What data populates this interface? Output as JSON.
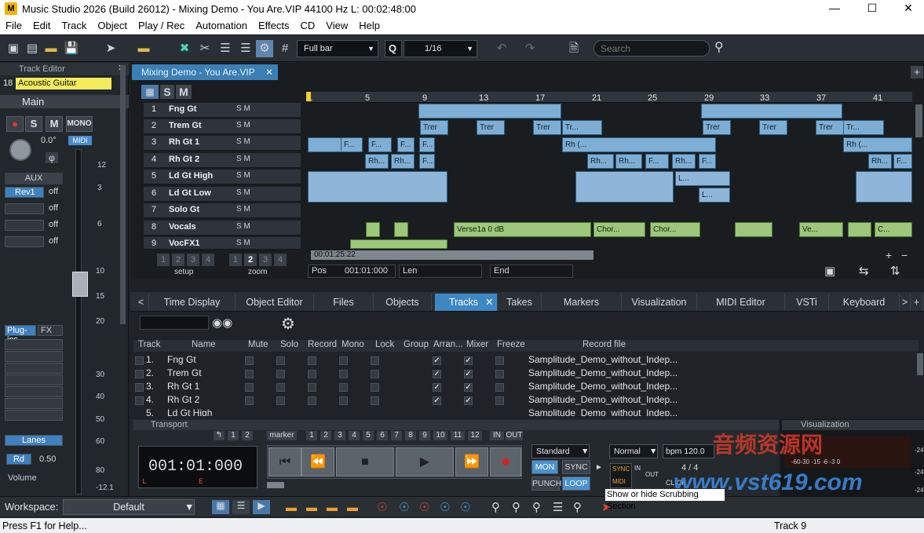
{
  "window": {
    "title": "Music Studio 2026 (Build 26012)  -  Mixing Demo - You Are.VIP    44100 Hz L: 00:02:48:00",
    "logo": "M"
  },
  "menu": [
    "File",
    "Edit",
    "Track",
    "Object",
    "Play / Rec",
    "Automation",
    "Effects",
    "CD",
    "View",
    "Help"
  ],
  "toolbar": {
    "snap_select": "Full bar",
    "quantize_label": "Q",
    "quantize_value": "1/16",
    "search_placeholder": "Search"
  },
  "track_editor": {
    "title": "Track Editor",
    "track_number": "18",
    "track_name": "Acoustic Guitar",
    "section": "Main",
    "buttons": [
      "S",
      "M",
      "MONO"
    ],
    "pan_value": "0.0°",
    "midi_label": "MIDI",
    "phase_symbol": "φ",
    "aux_label": "AUX",
    "sends": [
      {
        "name": "Rev1",
        "state": "off"
      },
      {
        "name": "",
        "state": "off"
      },
      {
        "name": "",
        "state": "off"
      },
      {
        "name": "",
        "state": "off"
      }
    ],
    "plugins_label": "Plug-ins",
    "fx_label": "FX",
    "lanes_label": "Lanes",
    "rd_label": "Rd",
    "rd_value": "0.50",
    "volume_label": "Volume",
    "scale": [
      "12",
      "3",
      "6",
      "10",
      "15",
      "20",
      "30",
      "40",
      "50",
      "60",
      "80",
      "-12.1"
    ]
  },
  "arranger": {
    "file_tab": "Mixing Demo - You Are.VIP",
    "s_label": "S",
    "m_label": "M",
    "ruler": [
      "1",
      "5",
      "9",
      "13",
      "17",
      "21",
      "25",
      "29",
      "33",
      "37",
      "41"
    ],
    "tracks": [
      {
        "num": "1",
        "name": "Fng Gt"
      },
      {
        "num": "2",
        "name": "Trem Gt"
      },
      {
        "num": "3",
        "name": "Rh Gt 1"
      },
      {
        "num": "4",
        "name": "Rh Gt 2"
      },
      {
        "num": "5",
        "name": "Ld Gt High"
      },
      {
        "num": "6",
        "name": "Ld Gt Low"
      },
      {
        "num": "7",
        "name": "Solo Gt"
      },
      {
        "num": "8",
        "name": "Vocals"
      },
      {
        "num": "9",
        "name": "VocFX1"
      }
    ],
    "sm_label": "S M",
    "clip_texts": {
      "trem": "Trer",
      "trem_fx": "Tr...",
      "rh1": "Rh (...",
      "rh2": "Rh...",
      "f": "F...",
      "l": "L...",
      "verse": "Verse1a    0 dB",
      "chor1": "Chor...",
      "chor2": "Chor...",
      "ve": "Ve...",
      "c": "C..."
    },
    "setup_label": "setup",
    "zoom_label": "zoom",
    "setup_nums": [
      "1",
      "2",
      "3",
      "4"
    ],
    "zoom_nums": [
      "1",
      "2",
      "3",
      "4"
    ],
    "time_display": "00:01:25:22",
    "pos_label": "Pos",
    "pos_value": "001:01:000",
    "len_label": "Len",
    "end_label": "End"
  },
  "bottom_tabs": [
    "Time Display",
    "Object Editor",
    "Files",
    "Objects",
    "Tracks",
    "Takes",
    "Markers",
    "Visualization",
    "MIDI Editor",
    "VSTi",
    "Keyboard"
  ],
  "tracks_manager": {
    "columns": [
      "Track",
      "Name",
      "Mute",
      "Solo",
      "Record",
      "Mono",
      "Lock",
      "Group",
      "Arran...",
      "Mixer",
      "Freeze",
      "Record file"
    ],
    "rows": [
      {
        "num": "1.",
        "name": "Fng Gt",
        "file": "Samplitude_Demo_without_Indep..."
      },
      {
        "num": "2.",
        "name": "Trem Gt",
        "file": "Samplitude_Demo_without_Indep..."
      },
      {
        "num": "3.",
        "name": "Rh Gt 1",
        "file": "Samplitude_Demo_without_Indep..."
      },
      {
        "num": "4.",
        "name": "Rh Gt 2",
        "file": "Samplitude_Demo_without_Indep..."
      },
      {
        "num": "5.",
        "name": "Ld Gt High",
        "file": "Samplitude_Demo_without_Indep..."
      }
    ]
  },
  "transport": {
    "title": "Transport",
    "marker_label": "marker",
    "marker_nums": [
      "1",
      "2",
      "3",
      "4",
      "5",
      "6",
      "7",
      "8",
      "9",
      "10",
      "11",
      "12"
    ],
    "loop_nums": [
      "1",
      "2"
    ],
    "in_label": "IN",
    "out_label": "OUT",
    "time": "001:01:000",
    "l_label": "L",
    "e_label": "E",
    "mode_select": "Standard",
    "mon": "MON",
    "sync": "SYNC",
    "punch": "PUNCH",
    "loop": "LOOP",
    "normal_select": "Normal",
    "bpm_label": "bpm",
    "bpm_value": "120.0",
    "sync_badge": "SYNC",
    "midi_badge": "MIDI",
    "in_badge": "IN",
    "out_badge": "OUT",
    "sig": "4 / 4",
    "click": "CLICK"
  },
  "visualization": {
    "title": "Visualization",
    "scale": [
      "-24",
      "-24",
      "-24"
    ],
    "ticks": "-60-30 -15 -6 -3 0"
  },
  "workspace": {
    "label": "Workspace:",
    "value": "Default"
  },
  "tooltip": "Show or hide Scrubbing Section",
  "watermark_cn": "音频资源网",
  "watermark_url": "www.vst619.com",
  "status": {
    "help": "Press F1 for Help...",
    "track": "Track 9"
  }
}
